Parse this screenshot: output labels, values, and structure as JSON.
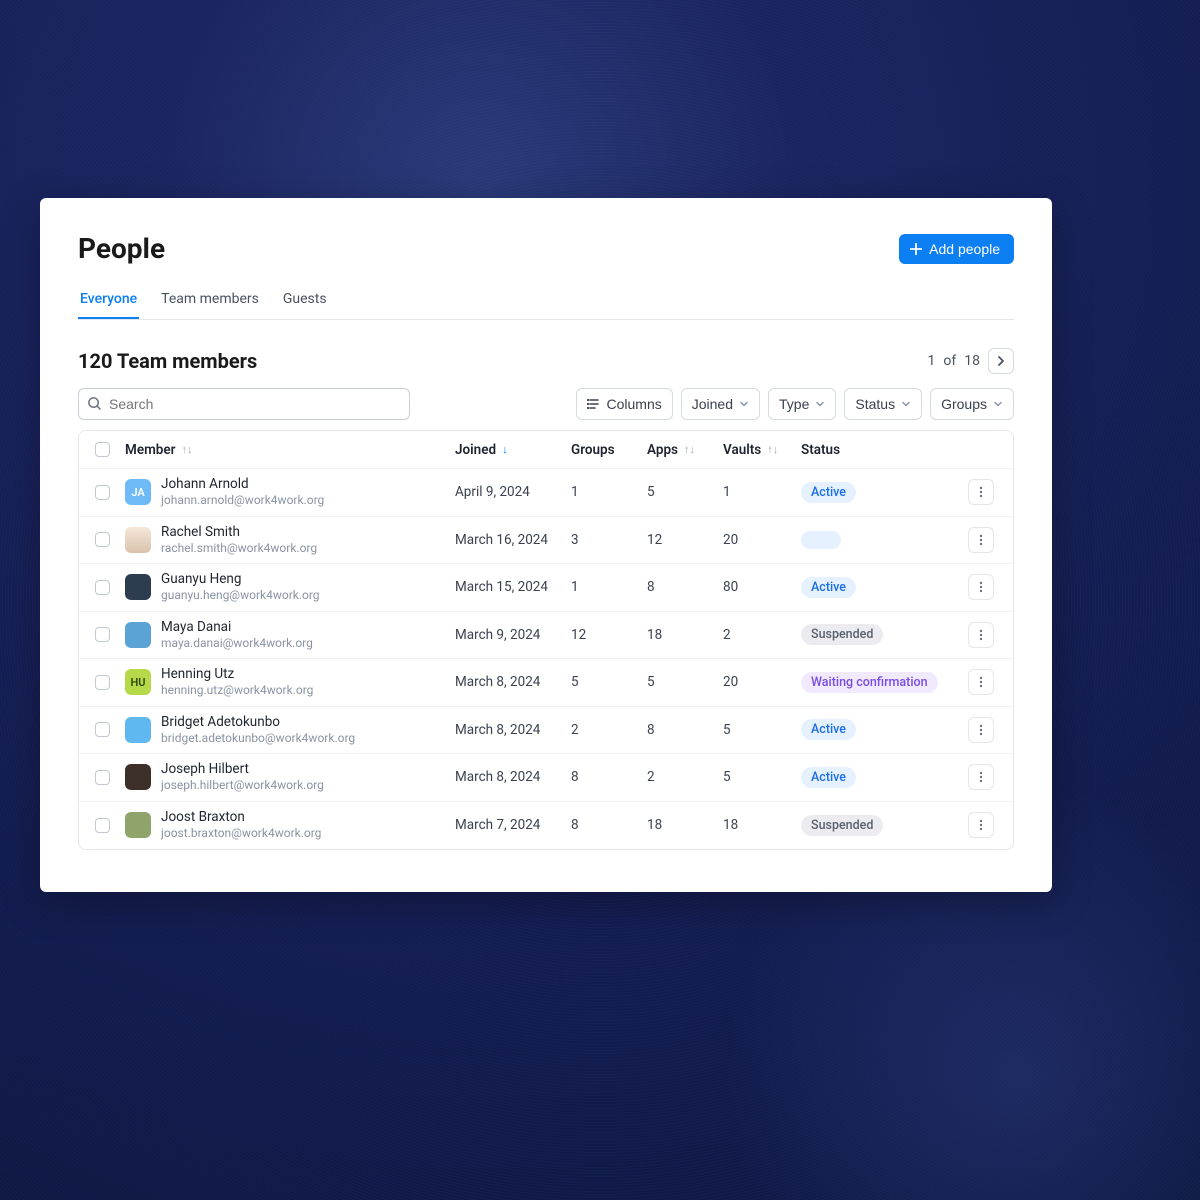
{
  "page_title": "People",
  "add_button": "Add people",
  "tabs": [
    {
      "label": "Everyone",
      "active": true
    },
    {
      "label": "Team members",
      "active": false
    },
    {
      "label": "Guests",
      "active": false
    }
  ],
  "count_title": "120 Team members",
  "pagination": {
    "current": "1",
    "of_label": "of",
    "total": "18"
  },
  "search_placeholder": "Search",
  "filters": {
    "columns": "Columns",
    "joined": "Joined",
    "type": "Type",
    "status": "Status",
    "groups": "Groups"
  },
  "columns": {
    "member": "Member",
    "joined": "Joined",
    "groups": "Groups",
    "apps": "Apps",
    "vaults": "Vaults",
    "status": "Status"
  },
  "rows": [
    {
      "avatar": "JA",
      "avclass": "av-ja",
      "name": "Johann Arnold",
      "email": "johann.arnold@work4work.org",
      "joined": "April 9, 2024",
      "groups": "1",
      "apps": "5",
      "vaults": "1",
      "status": "Active"
    },
    {
      "avatar": "",
      "avclass": "av-rs",
      "name": "Rachel Smith",
      "email": "rachel.smith@work4work.org",
      "joined": "March 16, 2024",
      "groups": "3",
      "apps": "12",
      "vaults": "20",
      "status": ""
    },
    {
      "avatar": "",
      "avclass": "av-gh",
      "name": "Guanyu Heng",
      "email": "guanyu.heng@work4work.org",
      "joined": "March 15, 2024",
      "groups": "1",
      "apps": "8",
      "vaults": "80",
      "status": "Active"
    },
    {
      "avatar": "",
      "avclass": "av-md",
      "name": "Maya Danai",
      "email": "maya.danai@work4work.org",
      "joined": "March 9, 2024",
      "groups": "12",
      "apps": "18",
      "vaults": "2",
      "status": "Suspended"
    },
    {
      "avatar": "HU",
      "avclass": "av-hu",
      "name": "Henning Utz",
      "email": "henning.utz@work4work.org",
      "joined": "March 8, 2024",
      "groups": "5",
      "apps": "5",
      "vaults": "20",
      "status": "Waiting confirmation"
    },
    {
      "avatar": "",
      "avclass": "av-ba",
      "name": "Bridget Adetokunbo",
      "email": "bridget.adetokunbo@work4work.org",
      "joined": "March 8, 2024",
      "groups": "2",
      "apps": "8",
      "vaults": "5",
      "status": "Active"
    },
    {
      "avatar": "",
      "avclass": "av-jh",
      "name": "Joseph Hilbert",
      "email": "joseph.hilbert@work4work.org",
      "joined": "March 8, 2024",
      "groups": "8",
      "apps": "2",
      "vaults": "5",
      "status": "Active"
    },
    {
      "avatar": "",
      "avclass": "av-jb",
      "name": "Joost Braxton",
      "email": "joost.braxton@work4work.org",
      "joined": "March 7, 2024",
      "groups": "8",
      "apps": "18",
      "vaults": "18",
      "status": "Suspended"
    }
  ]
}
